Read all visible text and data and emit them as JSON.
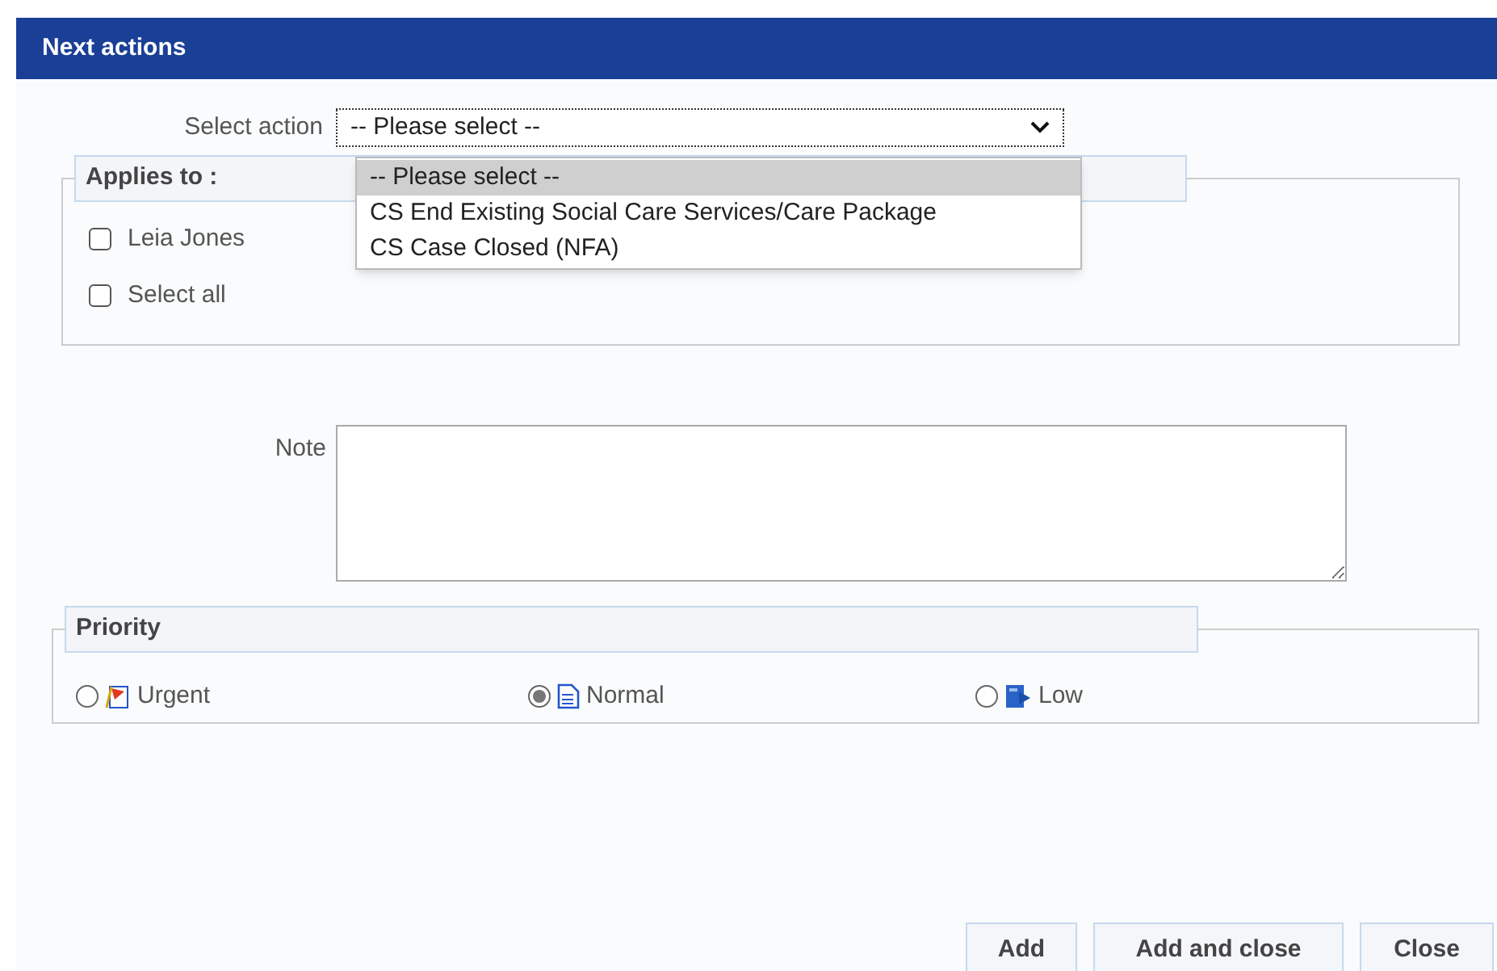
{
  "header": {
    "title": "Next actions"
  },
  "select_action": {
    "label": "Select action",
    "value": "-- Please select --",
    "expanded": true,
    "options": [
      {
        "label": "-- Please select --",
        "selected": true
      },
      {
        "label": "CS End Existing Social Care Services/Care Package",
        "selected": false
      },
      {
        "label": "CS Case Closed (NFA)",
        "selected": false
      }
    ]
  },
  "applies_to": {
    "legend": "Applies to :",
    "items": [
      {
        "label": "Leia Jones",
        "checked": false
      },
      {
        "label": "Select all",
        "checked": false
      }
    ]
  },
  "note": {
    "label": "Note"
  },
  "priority": {
    "legend": "Priority",
    "options": [
      {
        "label": "Urgent",
        "kind": "urgent",
        "selected": false
      },
      {
        "label": "Normal",
        "kind": "normal",
        "selected": true
      },
      {
        "label": "Low",
        "kind": "low",
        "selected": false
      }
    ]
  },
  "buttons": [
    "Add",
    "Add and close",
    "Close"
  ]
}
